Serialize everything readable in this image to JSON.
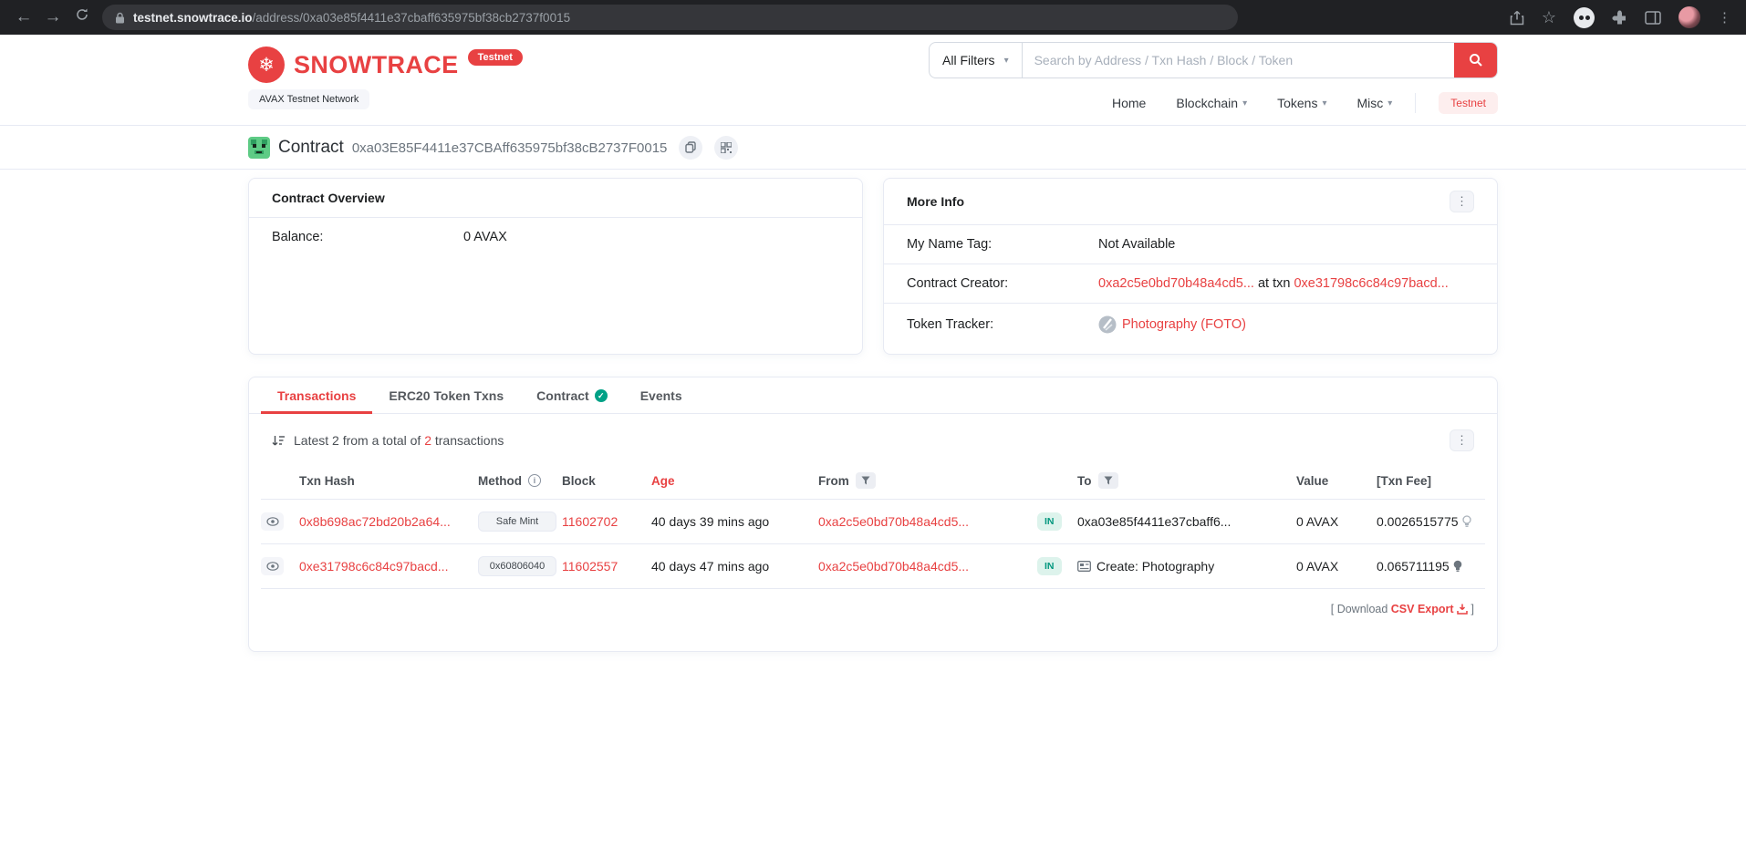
{
  "colors": {
    "accent": "#e84142",
    "link": "#e84142",
    "in_badge_bg": "#ddf3ec",
    "in_badge_text": "#02977e",
    "nav_testnet_bg": "#fdeeee",
    "browser_bar": "#202124"
  },
  "icons": {
    "back": "←",
    "forward": "→",
    "star": "☆",
    "menu_dots": "⋮",
    "chevron_down": "▾",
    "snowflake": "❄",
    "check": "✓",
    "info": "i"
  },
  "browser": {
    "host": "testnet.snowtrace.io",
    "path": "/address/0xa03e85f4411e37cbaff635975bf38cb2737f0015"
  },
  "header": {
    "brand": "SNOWTRACE",
    "brand_badge": "Testnet",
    "network": "AVAX Testnet Network",
    "search_filter": "All Filters",
    "search_placeholder": "Search by Address / Txn Hash / Block / Token",
    "nav": {
      "home": "Home",
      "blockchain": "Blockchain",
      "tokens": "Tokens",
      "misc": "Misc",
      "testnet": "Testnet"
    }
  },
  "page_title": {
    "label": "Contract",
    "address": "0xa03E85F4411e37CBAff635975bf38cB2737F0015"
  },
  "overview": {
    "title": "Contract Overview",
    "balance_label": "Balance:",
    "balance_value": "0 AVAX"
  },
  "more_info": {
    "title": "More Info",
    "name_tag_label": "My Name Tag:",
    "name_tag_value": "Not Available",
    "creator_label": "Contract Creator:",
    "creator_address": "0xa2c5e0bd70b48a4cd5...",
    "creator_mid": "at txn",
    "creator_txn": "0xe31798c6c84c97bacd...",
    "token_label": "Token Tracker:",
    "token_value": "Photography (FOTO)"
  },
  "tabs": {
    "transactions": "Transactions",
    "erc20": "ERC20 Token Txns",
    "contract": "Contract",
    "events": "Events"
  },
  "transactions": {
    "summary_prefix": "Latest 2 from a total of",
    "summary_count": "2",
    "summary_suffix": "transactions",
    "columns": {
      "hash": "Txn Hash",
      "method": "Method",
      "block": "Block",
      "age": "Age",
      "from": "From",
      "to": "To",
      "value": "Value",
      "fee": "[Txn Fee]"
    },
    "rows": [
      {
        "hash": "0x8b698ac72bd20b2a64...",
        "method": "Safe Mint",
        "block": "11602702",
        "age": "40 days 39 mins ago",
        "from": "0xa2c5e0bd70b48a4cd5...",
        "direction": "IN",
        "to": "0xa03e85f4411e37cbaff6...",
        "value": "0 AVAX",
        "fee": "0.0026515775"
      },
      {
        "hash": "0xe31798c6c84c97bacd...",
        "method": "0x60806040",
        "block": "11602557",
        "age": "40 days 47 mins ago",
        "from": "0xa2c5e0bd70b48a4cd5...",
        "direction": "IN",
        "to": "Create: Photography",
        "value": "0 AVAX",
        "fee": "0.065711195"
      }
    ],
    "download_open": "[",
    "download_label": "Download",
    "download_link": "CSV Export",
    "download_close": "]"
  }
}
